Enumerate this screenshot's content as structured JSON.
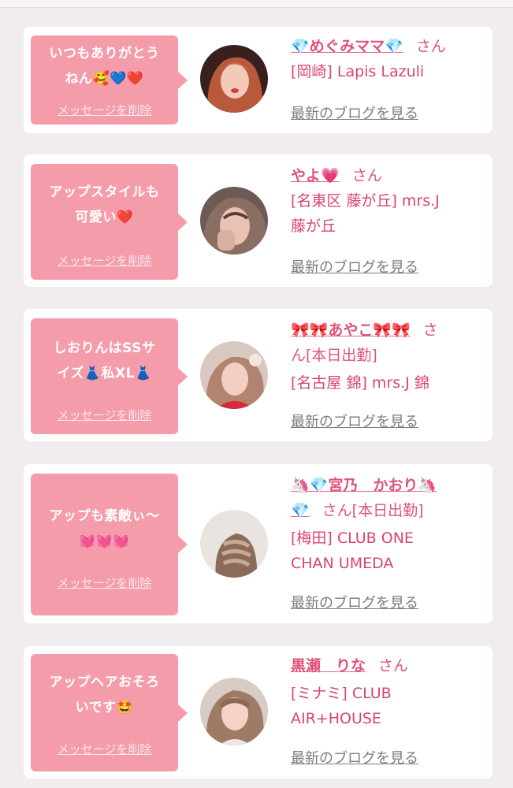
{
  "cards": [
    {
      "message_lines": [
        "いつもありがとう",
        "ねん🥰💙❤️"
      ],
      "delete_label": "メッセージを削除",
      "name_lines": [
        "💎めぐみママ💎"
      ],
      "san": "さん",
      "shop_lines": [
        "[岡崎] Lapis Lazuli"
      ],
      "blog_label": "最新のブログを見る"
    },
    {
      "message_lines": [
        "アップスタイルも",
        "可愛い❤️"
      ],
      "delete_label": "メッセージを削除",
      "name_lines": [
        "やよ💗"
      ],
      "san": "さん",
      "shop_lines": [
        "[名東区 藤が丘] mrs.J",
        "藤が丘"
      ],
      "blog_label": "最新のブログを見る"
    },
    {
      "message_lines": [
        "しおりんはSSサ",
        "イズ👗私XL👗"
      ],
      "delete_label": "メッセージを削除",
      "name_lines": [
        "🎀🎀あやこ🎀🎀"
      ],
      "san": "さ",
      "name_tail": "ん[本日出勤]",
      "shop_lines": [
        "[名古屋 錦] mrs.J 錦"
      ],
      "blog_label": "最新のブログを見る"
    },
    {
      "message_lines": [
        "アップも素敵ぃ〜",
        "💓💓💓"
      ],
      "delete_label": "メッセージを削除",
      "name_lines": [
        "🦄💎宮乃　かおり🦄",
        "💎"
      ],
      "san": "さん[本日出勤]",
      "shop_lines": [
        "[梅田] CLUB ONE",
        "CHAN UMEDA"
      ],
      "blog_label": "最新のブログを見る"
    },
    {
      "message_lines": [
        "アップヘアおそろ",
        "いです🤩"
      ],
      "delete_label": "メッセージを削除",
      "name_lines": [
        "黒瀬　りな"
      ],
      "san": "さん",
      "shop_lines": [
        "[ミナミ] CLUB",
        "AIR+HOUSE"
      ],
      "blog_label": "最新のブログを見る"
    }
  ],
  "colors": {
    "bubble": "#f59cab",
    "name": "#e05279",
    "shop": "#d9466c",
    "blog_link": "#7c7c7c",
    "background": "#f1eced"
  },
  "icons": [
    "gem-icon",
    "heart-icon",
    "ribbon-icon",
    "unicorn-icon",
    "dress-icon"
  ]
}
